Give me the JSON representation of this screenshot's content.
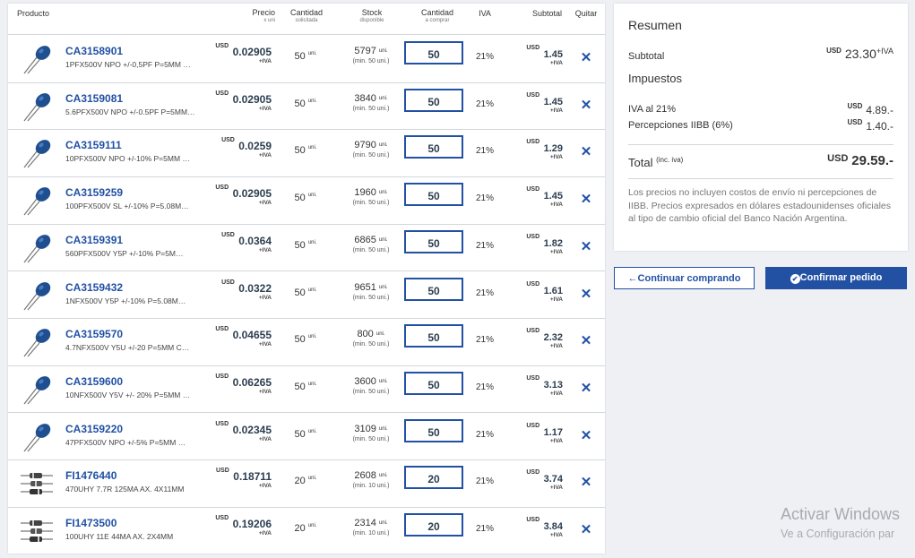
{
  "table": {
    "headers": {
      "product": "Producto",
      "price": "Precio",
      "price_sub": "x uni",
      "qty_req": "Cantidad",
      "qty_req_sub": "solicitada",
      "stock": "Stock",
      "stock_sub": "disponible",
      "qty_buy": "Cantidad",
      "qty_buy_sub": "a comprar",
      "iva": "IVA",
      "subtotal": "Subtotal",
      "remove": "Quitar"
    },
    "rows": [
      {
        "code": "CA3158901",
        "desc": "1PFX500V NPO +/-0,5PF P=5MM …",
        "cur": "USD",
        "price": "0.02905",
        "iva_tag": "+IVA",
        "qty": "50",
        "unit": "uni.",
        "stock": "5797",
        "min": "(min. 50 uni.)",
        "buy": "50",
        "iva": "21%",
        "subtotal": "1.45",
        "thumb": "capacitor",
        "remove": "✕"
      },
      {
        "code": "CA3159081",
        "desc": "5.6PFX500V NPO +/-0.5PF P=5MM…",
        "cur": "USD",
        "price": "0.02905",
        "iva_tag": "+IVA",
        "qty": "50",
        "unit": "uni.",
        "stock": "3840",
        "min": "(min. 50 uni.)",
        "buy": "50",
        "iva": "21%",
        "subtotal": "1.45",
        "thumb": "capacitor",
        "remove": "✕"
      },
      {
        "code": "CA3159111",
        "desc": "10PFX500V NPO +/-10% P=5MM …",
        "cur": "USD",
        "price": "0.0259",
        "iva_tag": "+IVA",
        "qty": "50",
        "unit": "uni.",
        "stock": "9790",
        "min": "(min. 50 uni.)",
        "buy": "50",
        "iva": "21%",
        "subtotal": "1.29",
        "thumb": "capacitor",
        "remove": "✕"
      },
      {
        "code": "CA3159259",
        "desc": "100PFX500V SL +/-10% P=5.08M…",
        "cur": "USD",
        "price": "0.02905",
        "iva_tag": "+IVA",
        "qty": "50",
        "unit": "uni.",
        "stock": "1960",
        "min": "(min. 50 uni.)",
        "buy": "50",
        "iva": "21%",
        "subtotal": "1.45",
        "thumb": "capacitor",
        "remove": "✕"
      },
      {
        "code": "CA3159391",
        "desc": "560PFX500V Y5P +/-10% P=5M…",
        "cur": "USD",
        "price": "0.0364",
        "iva_tag": "+IVA",
        "qty": "50",
        "unit": "uni.",
        "stock": "6865",
        "min": "(min. 50 uni.)",
        "buy": "50",
        "iva": "21%",
        "subtotal": "1.82",
        "thumb": "capacitor",
        "remove": "✕"
      },
      {
        "code": "CA3159432",
        "desc": "1NFX500V Y5P +/-10% P=5.08M…",
        "cur": "USD",
        "price": "0.0322",
        "iva_tag": "+IVA",
        "qty": "50",
        "unit": "uni.",
        "stock": "9651",
        "min": "(min. 50 uni.)",
        "buy": "50",
        "iva": "21%",
        "subtotal": "1.61",
        "thumb": "capacitor",
        "remove": "✕"
      },
      {
        "code": "CA3159570",
        "desc": "4.7NFX500V Y5U +/-20 P=5MM C…",
        "cur": "USD",
        "price": "0.04655",
        "iva_tag": "+IVA",
        "qty": "50",
        "unit": "uni.",
        "stock": "800",
        "min": "(min. 50 uni.)",
        "buy": "50",
        "iva": "21%",
        "subtotal": "2.32",
        "thumb": "capacitor",
        "remove": "✕"
      },
      {
        "code": "CA3159600",
        "desc": "10NFX500V Y5V +/- 20% P=5MM …",
        "cur": "USD",
        "price": "0.06265",
        "iva_tag": "+IVA",
        "qty": "50",
        "unit": "uni.",
        "stock": "3600",
        "min": "(min. 50 uni.)",
        "buy": "50",
        "iva": "21%",
        "subtotal": "3.13",
        "thumb": "capacitor",
        "remove": "✕"
      },
      {
        "code": "CA3159220",
        "desc": "47PFX500V NPO +/-5% P=5MM …",
        "cur": "USD",
        "price": "0.02345",
        "iva_tag": "+IVA",
        "qty": "50",
        "unit": "uni.",
        "stock": "3109",
        "min": "(min. 50 uni.)",
        "buy": "50",
        "iva": "21%",
        "subtotal": "1.17",
        "thumb": "capacitor",
        "remove": "✕"
      },
      {
        "code": "FI1476440",
        "desc": "470UHY 7.7R 125MA AX. 4X11MM",
        "cur": "USD",
        "price": "0.18711",
        "iva_tag": "+IVA",
        "qty": "20",
        "unit": "uni.",
        "stock": "2608",
        "min": "(min. 10 uni.)",
        "buy": "20",
        "iva": "21%",
        "subtotal": "3.74",
        "thumb": "inductor",
        "remove": "✕"
      },
      {
        "code": "FI1473500",
        "desc": "100UHY 11E 44MA AX. 2X4MM",
        "cur": "USD",
        "price": "0.19206",
        "iva_tag": "+IVA",
        "qty": "20",
        "unit": "uni.",
        "stock": "2314",
        "min": "(min. 10 uni.)",
        "buy": "20",
        "iva": "21%",
        "subtotal": "3.84",
        "thumb": "inductor",
        "remove": "✕"
      }
    ]
  },
  "summary": {
    "title": "Resumen",
    "subtotal_label": "Subtotal",
    "subtotal_cur": "USD",
    "subtotal_value": "23.30",
    "subtotal_suffix": "+IVA",
    "taxes_title": "Impuestos",
    "iva_label": "IVA al 21%",
    "iva_cur": "USD",
    "iva_value": "4.89.-",
    "perc_label": "Percepciones IIBB (6%)",
    "perc_cur": "USD",
    "perc_value": "1.40.-",
    "total_label": "Total",
    "total_note": "(inc. iva)",
    "total_cur": "USD",
    "total_value": "29.59.-",
    "disclaimer": "Los precios no incluyen costos de envío ni percepciones de IIBB. Precios expresados en dólares estadounidenses oficiales al tipo de cambio oficial del Banco Nación Argentina."
  },
  "buttons": {
    "continue": "Continuar comprando",
    "continue_icon": "←",
    "confirm": "Confirmar pedido",
    "confirm_icon": "✔"
  },
  "watermark": {
    "line1": "Activar Windows",
    "line2": "Ve a Configuración par"
  },
  "colors": {
    "accent": "#2251a4",
    "capacitor": "#1f4f8f",
    "background": "#eef0f4"
  }
}
